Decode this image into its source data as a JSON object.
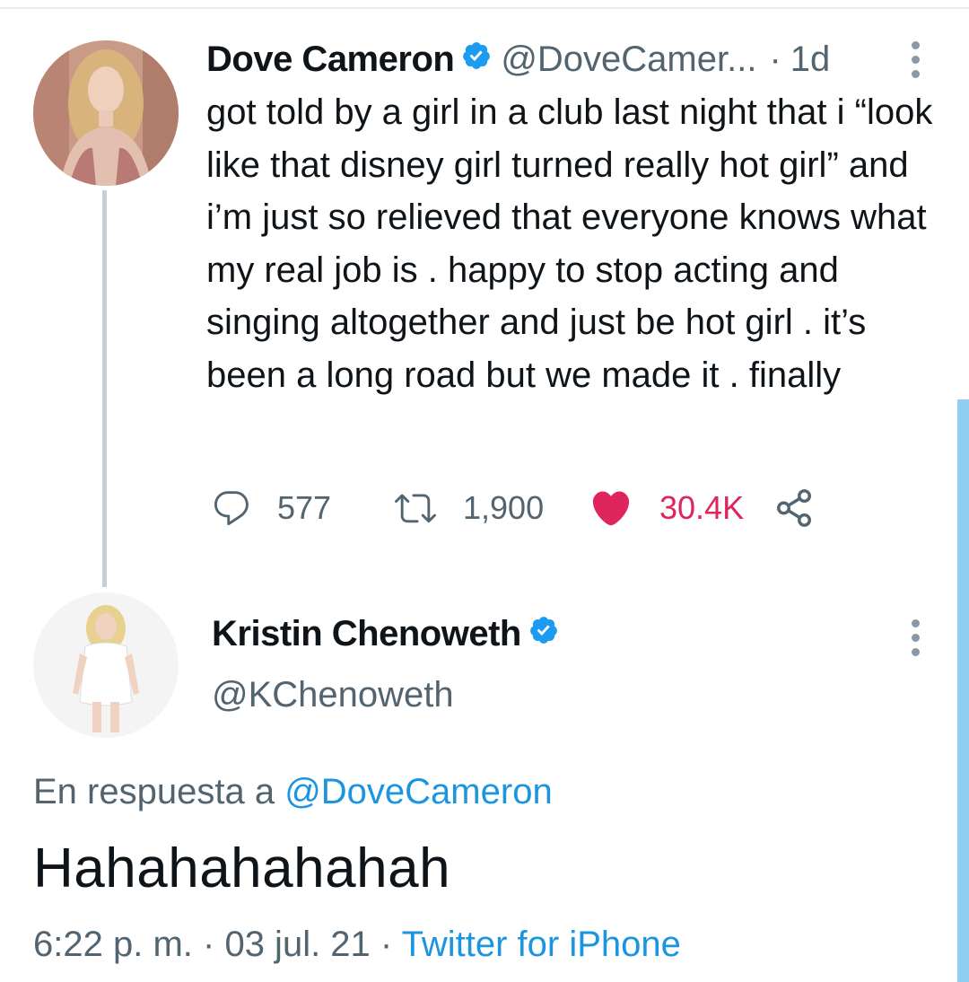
{
  "original_tweet": {
    "author_name": "Dove Cameron",
    "handle": "@DoveCamer...",
    "separator": "·",
    "time_ago": "1d",
    "text": "got told by a girl in a club last night that i “look like that disney girl turned really hot girl” and i’m just so relieved that everyone knows what my real job is . happy to stop acting and singing altogether and just be hot girl . it’s been a long road but we made it . finally",
    "replies_count": "577",
    "retweets_count": "1,900",
    "likes_count": "30.4K",
    "liked": true
  },
  "reply_tweet": {
    "author_name": "Kristin Chenoweth",
    "handle": "@KChenoweth",
    "reply_to_prefix": "En respuesta a",
    "reply_to_handle": "@DoveCameron",
    "text": "Hahahahahahah",
    "time": "6:22 p. m.",
    "separator": "·",
    "date": "03 jul. 21",
    "source": "Twitter for iPhone"
  },
  "icons": {
    "verified": "verified-badge-icon",
    "more": "more-vertical-icon",
    "reply": "reply-bubble-icon",
    "retweet": "retweet-icon",
    "like": "heart-icon",
    "share": "share-icon"
  },
  "colors": {
    "primary_text": "#0f1419",
    "secondary_text": "#536471",
    "link": "#1b95e0",
    "like_active": "#e0245e",
    "verified": "#1d9bf0",
    "thread_line": "#c4cfd6",
    "scrollbar": "#8fcdf3"
  }
}
